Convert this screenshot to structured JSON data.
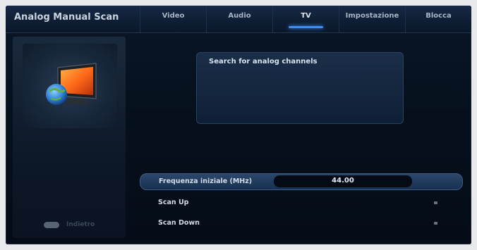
{
  "header": {
    "title": "Analog Manual Scan",
    "tabs": [
      {
        "label": "Video",
        "active": false
      },
      {
        "label": "Audio",
        "active": false
      },
      {
        "label": "TV",
        "active": true
      },
      {
        "label": "Impostazione",
        "active": false
      },
      {
        "label": "Blocca",
        "active": false
      }
    ]
  },
  "sidebar": {
    "icon": "tv-globe-icon",
    "hint": {
      "key_icon": "remote-key-icon",
      "label": "Indietro"
    }
  },
  "info": {
    "text": "Search for analog channels"
  },
  "settings": [
    {
      "label": "Frequenza iniziale (MHz)",
      "value": "44.00",
      "selected": true
    },
    {
      "label": "Scan Up",
      "selected": false
    },
    {
      "label": "Scan Down",
      "selected": false
    }
  ],
  "colors": {
    "accent": "#3b8ff0",
    "background": "#06101d",
    "text": "#d2dbe7"
  }
}
